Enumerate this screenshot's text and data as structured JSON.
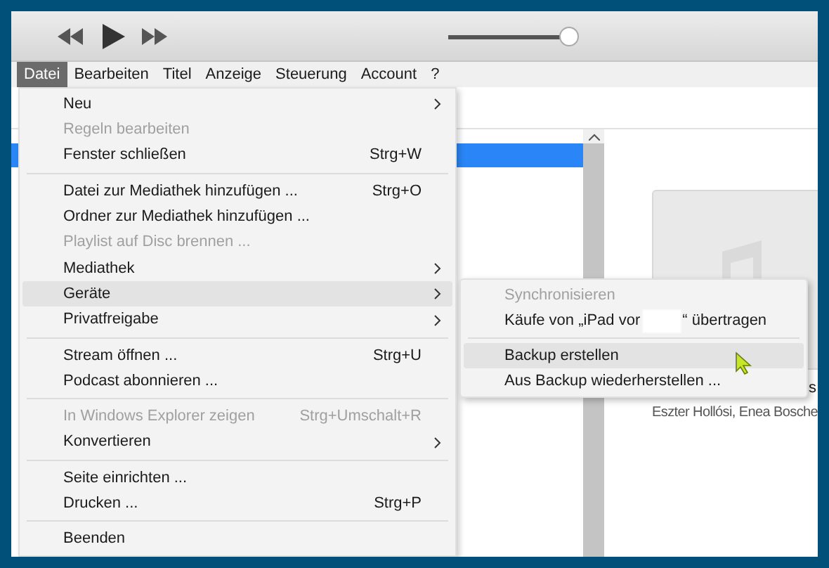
{
  "player": {
    "volume": {
      "level": 0.97
    }
  },
  "menubar": [
    {
      "label": "Datei",
      "selected": true
    },
    {
      "label": "Bearbeiten",
      "selected": false
    },
    {
      "label": "Titel",
      "selected": false
    },
    {
      "label": "Anzeige",
      "selected": false
    },
    {
      "label": "Steuerung",
      "selected": false
    },
    {
      "label": "Account",
      "selected": false
    },
    {
      "label": "?",
      "selected": false
    }
  ],
  "file_menu": [
    {
      "kind": "item",
      "label": "Neu",
      "submenu": true,
      "disabled": false,
      "selected": false
    },
    {
      "kind": "item",
      "label": "Regeln bearbeiten",
      "disabled": true,
      "selected": false
    },
    {
      "kind": "item",
      "label": "Fenster schließen",
      "shortcut": "Strg+W",
      "disabled": false,
      "selected": false
    },
    {
      "kind": "separator"
    },
    {
      "kind": "item",
      "label": "Datei zur Mediathek hinzufügen ...",
      "shortcut": "Strg+O",
      "disabled": false,
      "selected": false
    },
    {
      "kind": "item",
      "label": "Ordner zur Mediathek hinzufügen ...",
      "disabled": false,
      "selected": false
    },
    {
      "kind": "item",
      "label": "Playlist auf Disc brennen ...",
      "disabled": true,
      "selected": false
    },
    {
      "kind": "item",
      "label": "Mediathek",
      "submenu": true,
      "disabled": false,
      "selected": false
    },
    {
      "kind": "item",
      "label": "Geräte",
      "submenu": true,
      "disabled": false,
      "selected": true
    },
    {
      "kind": "item",
      "label": "Privatfreigabe",
      "submenu": true,
      "disabled": false,
      "selected": false
    },
    {
      "kind": "separator"
    },
    {
      "kind": "item",
      "label": "Stream öffnen ...",
      "shortcut": "Strg+U",
      "disabled": false,
      "selected": false
    },
    {
      "kind": "item",
      "label": "Podcast abonnieren ...",
      "disabled": false,
      "selected": false
    },
    {
      "kind": "separator"
    },
    {
      "kind": "item",
      "label": "In Windows Explorer zeigen",
      "shortcut": "Strg+Umschalt+R",
      "disabled": true,
      "selected": false
    },
    {
      "kind": "item",
      "label": "Konvertieren",
      "submenu": true,
      "disabled": false,
      "selected": false
    },
    {
      "kind": "separator"
    },
    {
      "kind": "item",
      "label": "Seite einrichten ...",
      "disabled": false,
      "selected": false
    },
    {
      "kind": "item",
      "label": "Drucken ...",
      "shortcut": "Strg+P",
      "disabled": false,
      "selected": false
    },
    {
      "kind": "separator"
    },
    {
      "kind": "item",
      "label": "Beenden",
      "disabled": false,
      "selected": false
    }
  ],
  "devices_submenu": [
    {
      "kind": "item",
      "label": "Synchronisieren",
      "disabled": true,
      "selected": false
    },
    {
      "kind": "redacted",
      "label": "Käufe von „iPad vor",
      "label_after": "“ übertragen",
      "disabled": false,
      "selected": false
    },
    {
      "kind": "separator"
    },
    {
      "kind": "item",
      "label": "Backup erstellen",
      "disabled": false,
      "selected": true
    },
    {
      "kind": "item",
      "label": "Aus Backup wiederherstellen ...",
      "disabled": false,
      "selected": false
    }
  ],
  "album": {
    "title_fragment": "s",
    "artists": "Eszter Hollósi, Enea Bosche"
  }
}
